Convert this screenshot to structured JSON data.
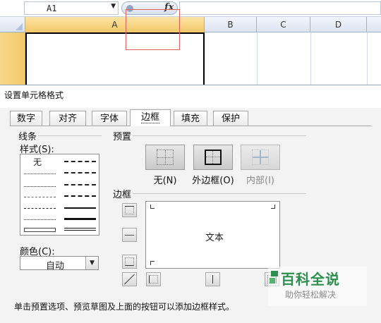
{
  "formula_bar": {
    "cell_reference": "A1",
    "name_box_arrow": "▼",
    "fx_label": "fx"
  },
  "columns": [
    "A",
    "B",
    "C",
    "D"
  ],
  "dialog": {
    "title": "设置单元格格式",
    "tabs": [
      {
        "label": "数字"
      },
      {
        "label": "对齐"
      },
      {
        "label": "字体"
      },
      {
        "label": "边框"
      },
      {
        "label": "填充"
      },
      {
        "label": "保护"
      }
    ],
    "active_tab": "边框",
    "line_group_label": "线条",
    "style_label": "样式(S):",
    "style_none": "无",
    "color_label": "颜色(C):",
    "color_value": "自动",
    "presets_label": "预置",
    "presets": [
      {
        "label": "无(N)",
        "disabled": false
      },
      {
        "label": "外边框(O)",
        "disabled": false
      },
      {
        "label": "内部(I)",
        "disabled": true
      }
    ],
    "border_label": "边框",
    "preview_text": "文本",
    "hint": "单击预置选项、预览草图及上面的按钮可以添加边框样式。"
  },
  "watermark": {
    "title": "百科全说",
    "subtitle": "助你轻松解决"
  },
  "colors": {
    "active_header": "#f5c868",
    "highlight_box": "#e06060",
    "watermark_green": "#2d8e4e"
  }
}
